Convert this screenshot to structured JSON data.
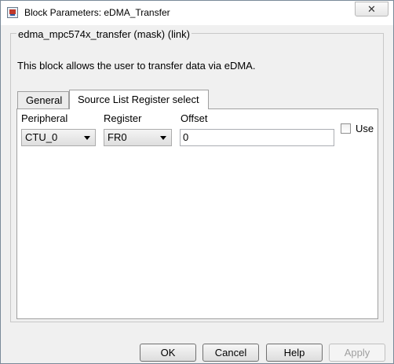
{
  "window": {
    "title": "Block Parameters: eDMA_Transfer",
    "close_glyph": "✕",
    "icon": "simulink-block-icon"
  },
  "mask": {
    "group_label": "edma_mpc574x_transfer (mask) (link)",
    "description": "This block allows the user to transfer data via eDMA."
  },
  "tabs": [
    {
      "label": "General",
      "active": false
    },
    {
      "label": "Source List Register select",
      "active": true
    }
  ],
  "form": {
    "peripheral_label": "Peripheral",
    "peripheral_value": "CTU_0",
    "register_label": "Register",
    "register_value": "FR0",
    "offset_label": "Offset",
    "offset_value": "0",
    "use_label": "Use",
    "use_checked": false
  },
  "buttons": {
    "ok": "OK",
    "cancel": "Cancel",
    "help": "Help",
    "apply": "Apply"
  }
}
